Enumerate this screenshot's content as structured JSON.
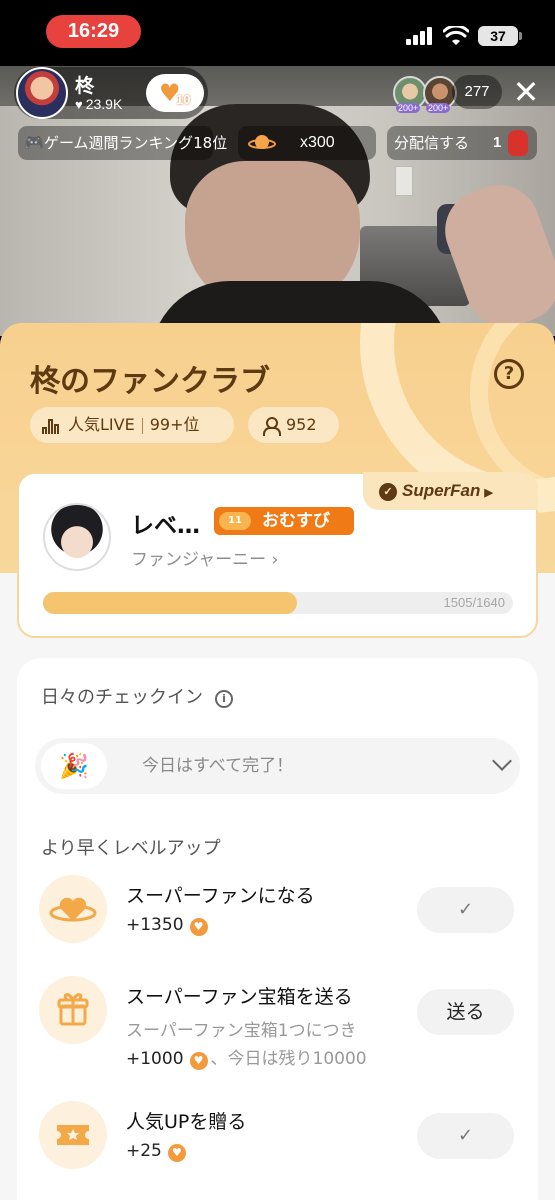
{
  "status_bar": {
    "time": "16:29",
    "battery": "37"
  },
  "live_header": {
    "host_name": "柊",
    "host_likes": "23.9K",
    "follow_level": "10",
    "viewer_badges": [
      "200+",
      "200+"
    ],
    "viewer_count": "277",
    "ranking_label": "ゲーム週間ランキング18位",
    "multiplier": "x300",
    "share_label": "分配信する",
    "share_count": "1"
  },
  "fan_club": {
    "title": "柊のファンクラブ",
    "popularity_label": "人気LIVE",
    "popularity_rank": "99+位",
    "member_count": "952"
  },
  "member": {
    "superfan_label": "SuperFan",
    "level_text": "レベ…",
    "level_badge": "おむすび",
    "journey_link": "ファンジャーニー ›",
    "progress_text": "1505/1640",
    "progress_current": 1505,
    "progress_total": 1640
  },
  "daily": {
    "checkin_title": "日々のチェックイン",
    "checkin_status": "今日はすべて完了！",
    "levelup_title": "より早くレベルアップ",
    "tasks": [
      {
        "title": "スーパーファンになる",
        "points": "+1350",
        "button": "✓",
        "icon": "planet-heart-icon"
      },
      {
        "title": "スーパーファン宝箱を送る",
        "subtitle": "スーパーファン宝箱1つにつき",
        "points": "+1000",
        "points_suffix": "、今日は残り10000",
        "button": "送る",
        "icon": "gift-icon"
      },
      {
        "title": "人気UPを贈る",
        "points": "+25",
        "button": "✓",
        "icon": "ticket-icon"
      }
    ]
  }
}
